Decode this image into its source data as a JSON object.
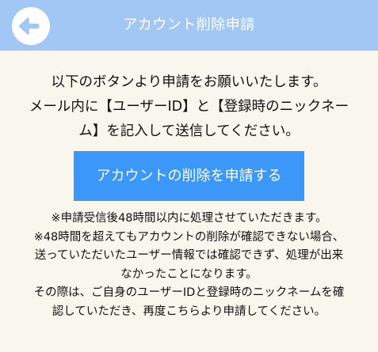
{
  "header": {
    "title": "アカウント削除申請",
    "back_icon": "arrow-left-icon",
    "color": "#a3c7f4"
  },
  "instructions": {
    "line1": "以下のボタンより申請をお願いいたします。",
    "line2": "メール内に【ユーザーID】と【登録時のニックネー",
    "line3": "ム】を記入して送信してください。"
  },
  "request_button": {
    "label": "アカウントの削除を申請する",
    "color": "#3b97f8"
  },
  "notes": {
    "line1": "※申請受信後48時間以内に処理させていただきます。",
    "line2": "※48時間を超えてもアカウントの削除が確認できない場合、",
    "line3": "送っていただいたユーザー情報では確認できず、処理が出来",
    "line4": "なかったことになります。",
    "line5": "その際は、ご自身のユーザーIDと登録時のニックネームを確",
    "line6": "認していただき、再度こちらより申請してください。"
  }
}
